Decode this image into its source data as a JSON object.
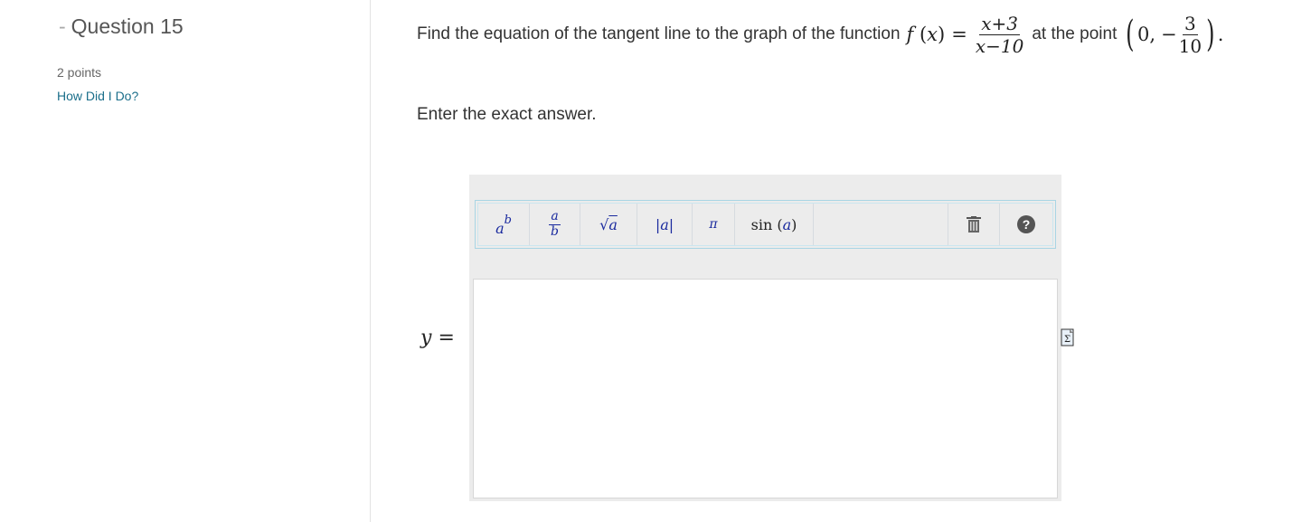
{
  "question": {
    "dash": "-",
    "title": "Question 15",
    "points": "2 points",
    "how_link": "How Did I Do?"
  },
  "prompt": {
    "text_before": "Find the equation of the tangent line to the graph of the function",
    "func_name": "f",
    "func_arg": "x",
    "equals": "=",
    "numerator": "x+3",
    "denominator": "x−10",
    "text_middle": "at the point",
    "point_x": "0,",
    "point_neg": "−",
    "point_num": "3",
    "point_den": "10",
    "period": "."
  },
  "instruction": "Enter the exact answer.",
  "answer": {
    "variable": "y",
    "equals": "=",
    "value": ""
  },
  "toolbar": {
    "buttons": [
      {
        "name": "exponent",
        "label": "a^b"
      },
      {
        "name": "fraction",
        "label": "a/b"
      },
      {
        "name": "sqrt",
        "label": "√a"
      },
      {
        "name": "abs",
        "label": "|a|"
      },
      {
        "name": "pi",
        "label": "π"
      },
      {
        "name": "sin",
        "label": "sin (a)"
      }
    ],
    "sup_base": "a",
    "sup_exp": "b",
    "frac_num": "a",
    "frac_den": "b",
    "sqrt_sym": "√",
    "sqrt_arg": "a",
    "abs_label": "|a|",
    "pi_label": "π",
    "sin_fn": "sin",
    "sin_arg": "a",
    "help_label": "?"
  },
  "icons": {
    "trash": "trash-icon",
    "help": "help-icon",
    "sigma": "sigma-icon"
  },
  "colors": {
    "link": "#1a6e8a",
    "math_blue": "#1a2a9e",
    "toolbar_border": "#a9d5e4"
  }
}
